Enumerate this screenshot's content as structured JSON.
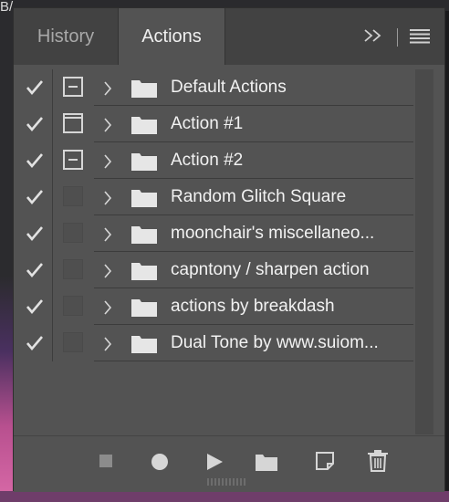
{
  "background": {
    "corner_text": "B/"
  },
  "tabs": [
    {
      "label": "History",
      "active": false
    },
    {
      "label": "Actions",
      "active": true
    }
  ],
  "header_icons": [
    "collapse-double-chevron-icon",
    "panel-menu-icon"
  ],
  "actions": [
    {
      "label": "Default Actions",
      "checked": true,
      "dialog": "partial"
    },
    {
      "label": "Action #1",
      "checked": true,
      "dialog": "on"
    },
    {
      "label": "Action #2",
      "checked": true,
      "dialog": "partial"
    },
    {
      "label": "Random Glitch Square",
      "checked": true,
      "dialog": "off"
    },
    {
      "label": "moonchair's miscellaneo...",
      "checked": true,
      "dialog": "off"
    },
    {
      "label": "capntony / sharpen action",
      "checked": true,
      "dialog": "off"
    },
    {
      "label": "actions by breakdash",
      "checked": true,
      "dialog": "off"
    },
    {
      "label": "Dual Tone by www.suiom...",
      "checked": true,
      "dialog": "off"
    }
  ],
  "footer_icons": [
    "stop-icon",
    "record-icon",
    "play-icon",
    "new-set-folder-icon",
    "new-action-icon",
    "delete-icon"
  ],
  "colors": {
    "panel": "#535353",
    "tabbar": "#424242",
    "text": "#f2f2f2",
    "icon": "#d6d6d6"
  }
}
